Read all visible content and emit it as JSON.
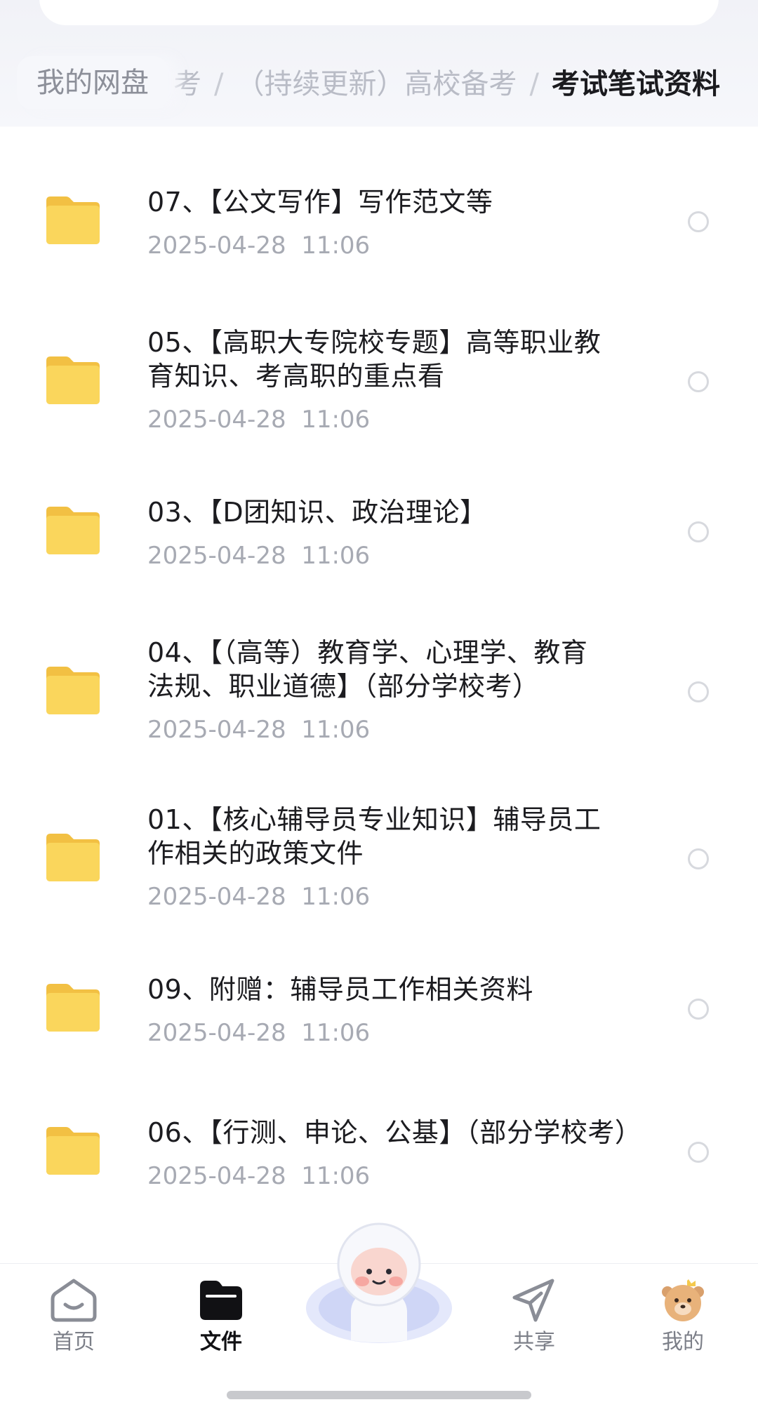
{
  "breadcrumb": {
    "root": "我的网盘",
    "trail": [
      "考",
      "（持续更新）高校备考"
    ],
    "separator": "/",
    "current": "考试笔试资料"
  },
  "files": [
    {
      "title_lines": [
        "07、【公文写作】写作范文等"
      ],
      "date": "2025-04-28  11:06"
    },
    {
      "title_lines": [
        "05、【高职大专院校专题】高等职业教",
        "育知识、考高职的重点看"
      ],
      "date": "2025-04-28  11:06"
    },
    {
      "title_lines": [
        "03、【D团知识、政治理论】"
      ],
      "date": "2025-04-28  11:06"
    },
    {
      "title_lines": [
        "04、【（高等）教育学、心理学、教育",
        "法规、职业道德】（部分学校考）"
      ],
      "date": "2025-04-28  11:06"
    },
    {
      "title_lines": [
        "01、【核心辅导员专业知识】辅导员工",
        "作相关的政策文件"
      ],
      "date": "2025-04-28  11:06"
    },
    {
      "title_lines": [
        "09、附赠：辅导员工作相关资料"
      ],
      "date": "2025-04-28  11:06"
    },
    {
      "title_lines": [
        "06、【行测、申论、公基】（部分学校考）"
      ],
      "date": "2025-04-28  11:06"
    }
  ],
  "tabbar": {
    "home": "首页",
    "files": "文件",
    "share": "共享",
    "mine": "我的"
  },
  "icons": {
    "folder": "folder-icon",
    "select": "radio-circle-icon",
    "home": "home-icon",
    "files": "files-folder-icon",
    "share": "paper-plane-icon",
    "mine": "avatar-bear-icon",
    "assistant": "assistant-mascot-icon"
  },
  "colors": {
    "folder": "#f9d055",
    "active_tab": "#111114",
    "inactive_tab": "#7c7f88",
    "date_text": "#a7aab3"
  }
}
